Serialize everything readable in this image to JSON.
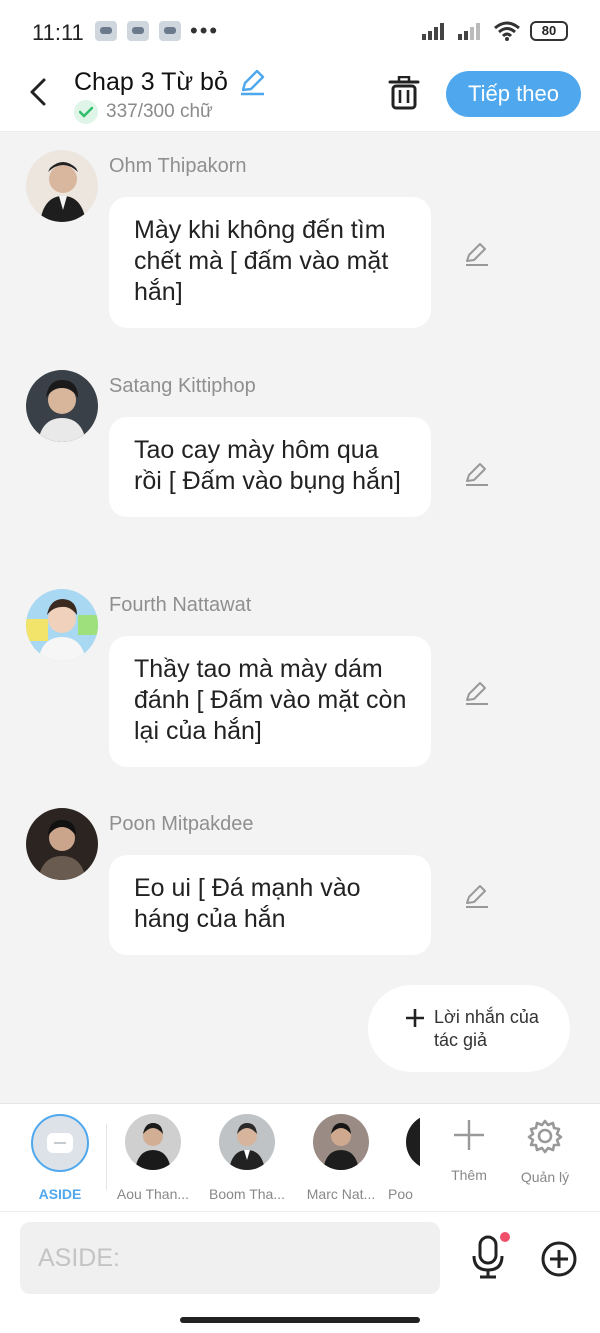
{
  "status_bar": {
    "time": "11:11",
    "overflow": "•••",
    "battery": "80"
  },
  "header": {
    "title": "Chap 3 Từ bỏ",
    "word_count": "337/300 chữ",
    "next_button": "Tiếp theo"
  },
  "messages": [
    {
      "sender": "Ohm Thipakorn",
      "text": "Mày khi không đến tìm chết mà [ đấm vào mặt hắn]"
    },
    {
      "sender": "Satang Kittiphop",
      "text": "Tao cay mày hôm qua rồi [ Đấm vào bụng hắn]"
    },
    {
      "sender": "Fourth Nattawat",
      "text": "Thầy tao mà mày dám đánh [ Đấm vào mặt còn lại của hắn]"
    },
    {
      "sender": "Poon Mitpakdee",
      "text": "Eo ui [ Đá mạnh vào háng của hắn"
    }
  ],
  "author_note": {
    "label": "Lời nhắn của tác giả"
  },
  "character_bar": {
    "aside": "ASIDE",
    "characters": [
      {
        "name": "Aou Than..."
      },
      {
        "name": "Boom Tha..."
      },
      {
        "name": "Marc Nat..."
      },
      {
        "name": "Poo"
      }
    ],
    "add_label": "Thêm",
    "manage_label": "Quản lý"
  },
  "input": {
    "placeholder": "ASIDE:"
  },
  "colors": {
    "accent": "#4fa8ee",
    "background": "#f3f3f3",
    "check": "#2fbf6b",
    "mic_dot": "#f04f6a"
  }
}
